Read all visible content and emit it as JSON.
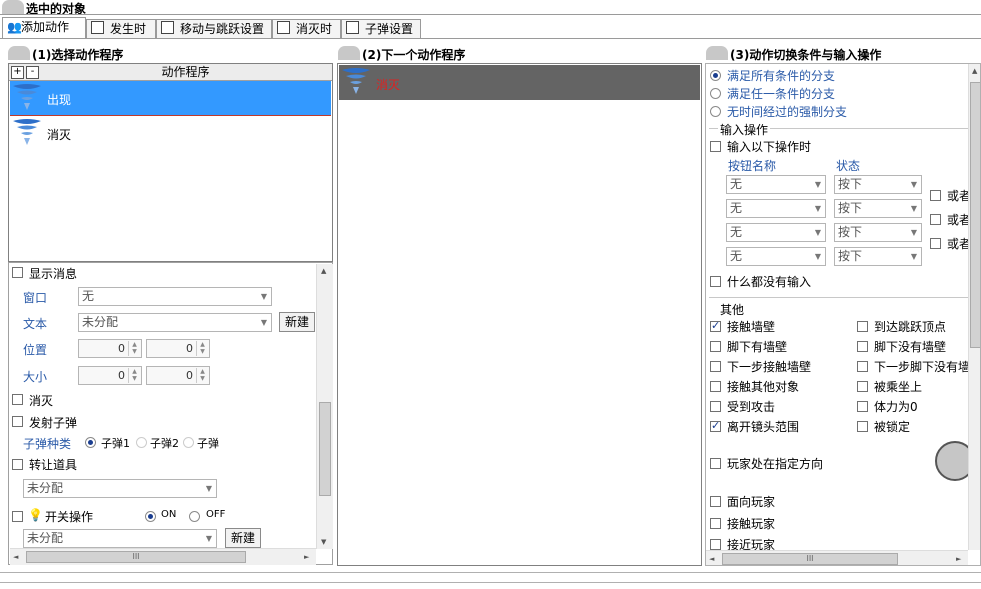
{
  "header": {
    "title": "选中的对象"
  },
  "tabs": [
    {
      "label": "添加动作",
      "icon": "people-icon"
    },
    {
      "label": "发生时",
      "icon": "edit-icon"
    },
    {
      "label": "移动与跳跃设置",
      "icon": "edit-icon"
    },
    {
      "label": "消灭时",
      "icon": "edit-icon"
    },
    {
      "label": "子弹设置",
      "icon": "edit-icon"
    }
  ],
  "left": {
    "title": "(1)选择动作程序",
    "list_header": "动作程序",
    "add_label": "+",
    "remove_label": "-",
    "items": [
      {
        "label": "出现",
        "selected": true
      },
      {
        "label": "消灭",
        "selected": false
      }
    ],
    "opts": {
      "show_message": "显示消息",
      "window_label": "窗口",
      "window_value": "无",
      "text_label": "文本",
      "text_value": "未分配",
      "new_button": "新建",
      "position_label": "位置",
      "size_label": "大小",
      "zero": "0",
      "destroy": "消灭",
      "fire_bullet": "发射子弹",
      "bullet_kind_label": "子弹种类",
      "bullet1": "子弹1",
      "bullet2": "子弹2",
      "bullet3": "子弹",
      "transfer_item": "转让道具",
      "transfer_value": "未分配",
      "switch_op": "开关操作",
      "on": "ON",
      "off": "OFF",
      "switch_value": "未分配",
      "new_button2": "新建"
    }
  },
  "middle": {
    "title": "(2)下一个动作程序",
    "item": "消灭"
  },
  "right": {
    "title": "(3)动作切换条件与输入操作",
    "branch_all": "满足所有条件的分支",
    "branch_any": "满足任一条件的分支",
    "branch_forced": "无时间经过的强制分支",
    "input_group": "输入操作",
    "input_when": "输入以下操作时",
    "button_name_label": "按钮名称",
    "state_label": "状态",
    "rows": [
      {
        "button": "无",
        "state": "按下",
        "or": "或者"
      },
      {
        "button": "无",
        "state": "按下",
        "or": "或者"
      },
      {
        "button": "无",
        "state": "按下",
        "or": "或者"
      },
      {
        "button": "无",
        "state": "按下",
        "or": ""
      }
    ],
    "no_input": "什么都没有输入",
    "other_group": "其他",
    "conditions_left": [
      {
        "label": "接触墙壁",
        "checked": true
      },
      {
        "label": "脚下有墙壁",
        "checked": false
      },
      {
        "label": "下一步接触墙壁",
        "checked": false
      },
      {
        "label": "接触其他对象",
        "checked": false
      },
      {
        "label": "受到攻击",
        "checked": false
      },
      {
        "label": "离开镜头范围",
        "checked": true
      }
    ],
    "conditions_right": [
      {
        "label": "到达跳跃顶点",
        "checked": false
      },
      {
        "label": "脚下没有墙壁",
        "checked": false
      },
      {
        "label": "下一步脚下没有墙",
        "checked": false
      },
      {
        "label": "被乘坐上",
        "checked": false
      },
      {
        "label": "体力为0",
        "checked": false
      },
      {
        "label": "被锁定",
        "checked": false
      }
    ],
    "player_direction": "玩家处在指定方向",
    "face_player": "面向玩家",
    "touch_player": "接触玩家",
    "near_player": "接近玩家"
  },
  "scroll_grip": "III",
  "colors": {
    "selection": "#3399ff",
    "middle_selection": "#646464",
    "accent_text": "#2a5aa8"
  }
}
